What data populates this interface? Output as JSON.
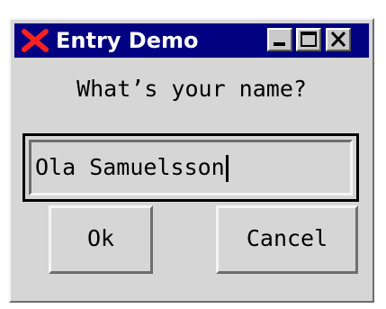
{
  "window": {
    "title": "Entry Demo",
    "titlebar_color": "#000080",
    "controls": [
      "minimize-icon",
      "maximize-icon",
      "close-icon"
    ]
  },
  "prompt": "What’s your name?",
  "entry": {
    "value": "Ola Samuelsson",
    "has_focus": true
  },
  "buttons": {
    "ok_label": "Ok",
    "cancel_label": "Cancel"
  },
  "colors": {
    "app_icon": "#ff2020",
    "background": "#d6d6d6"
  }
}
